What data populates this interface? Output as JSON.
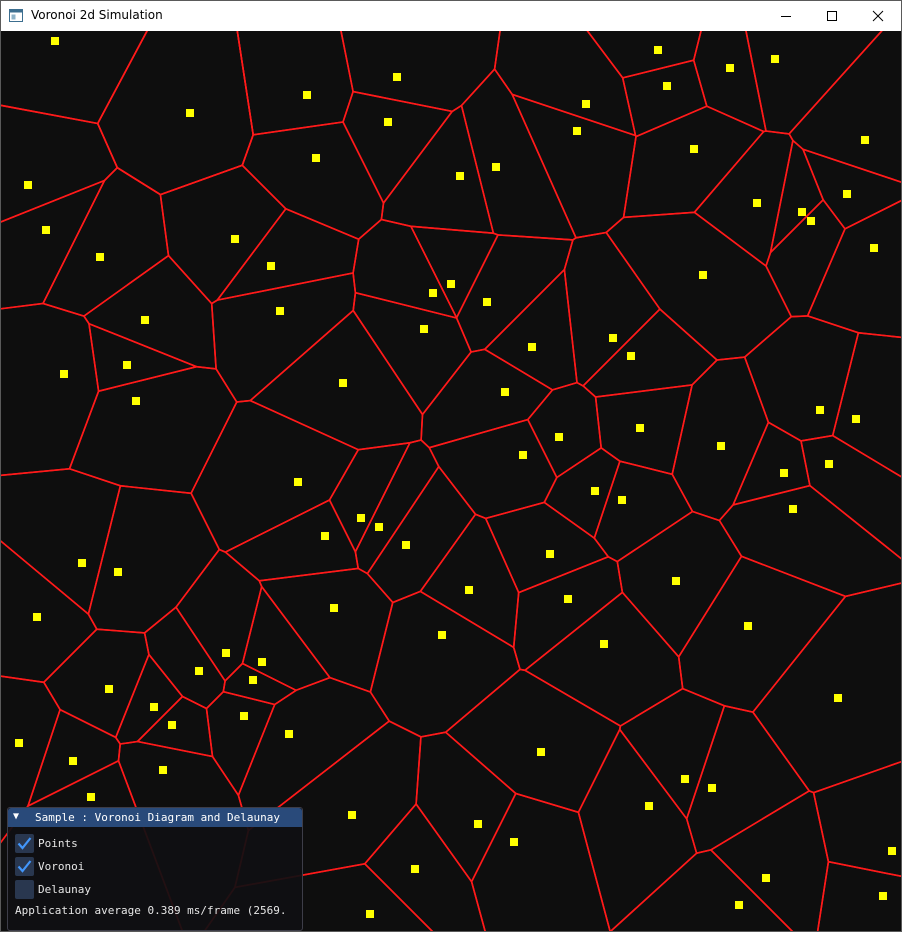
{
  "window": {
    "title": "Voronoi 2d Simulation",
    "controls": [
      "minimize",
      "maximize",
      "close"
    ]
  },
  "scene": {
    "background_color": "#0e0e0e",
    "edge_color": "#ff1a1a",
    "point_color": "#ffff00"
  },
  "panel": {
    "collapse_icon": "triangle-down-icon",
    "title": "Sample : Voronoi Diagram and Delaunay",
    "options": [
      {
        "label": "Points",
        "checked": true
      },
      {
        "label": "Voronoi",
        "checked": true
      },
      {
        "label": "Delaunay",
        "checked": false
      }
    ],
    "status": "Application average 0.389 ms/frame (2569."
  }
}
